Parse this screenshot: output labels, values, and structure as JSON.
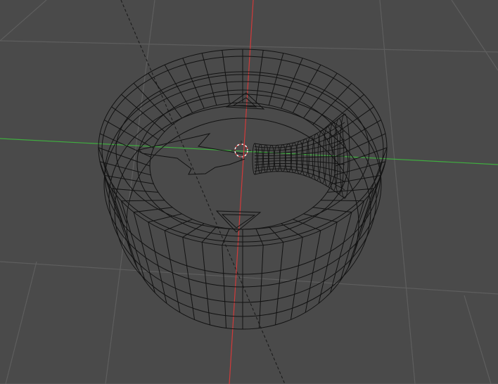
{
  "viewport": {
    "view": "3D viewport",
    "shading": "wireframe",
    "background_color": "#4a4a4a",
    "grid_color": "#5f5f5f",
    "x_axis_color": "#d23a3a",
    "y_axis_color": "#3fae3f",
    "wire_color": "#111111",
    "cursor_colors": [
      "#ffffff",
      "#d04040"
    ],
    "icons": [
      "3d-cursor-icon"
    ]
  }
}
